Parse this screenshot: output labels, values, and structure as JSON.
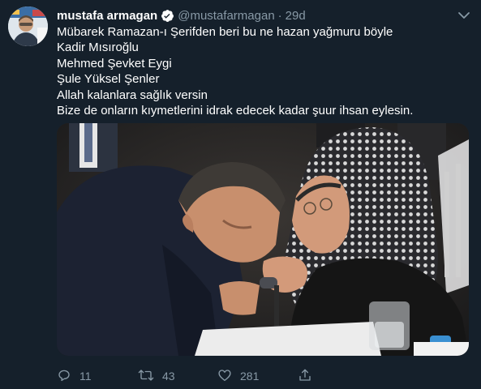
{
  "tweet": {
    "author_name": "mustafa armagan",
    "handle": "@mustafarmagan",
    "separator": "·",
    "time": "29d",
    "lines": [
      "Mübarek Ramazan-ı Şerifden beri bu ne hazan yağmuru böyle",
      "Kadir Mısıroğlu",
      "Mehmed Şevket Eygi",
      "Şule Yüksel Şenler",
      "Allah kalanlara sağlık versin",
      "Bize de onların kıymetlerini idrak edecek kadar şuur ihsan eylesin."
    ],
    "actions": {
      "reply_count": "11",
      "retweet_count": "43",
      "like_count": "281"
    }
  },
  "colors": {
    "background": "#15202b",
    "secondary_text": "#8899a6",
    "verified_blue": "#1da1f2"
  },
  "icons": [
    "chevron-down-icon",
    "verified-badge-icon",
    "reply-icon",
    "retweet-icon",
    "like-icon",
    "share-icon"
  ]
}
